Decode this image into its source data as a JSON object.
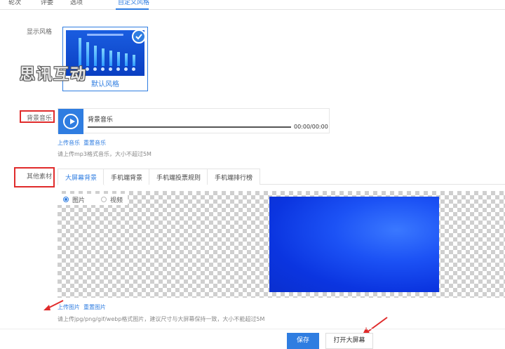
{
  "top_tabs": [
    {
      "label": "轮次",
      "active": false
    },
    {
      "label": "评委",
      "active": false
    },
    {
      "label": "选项",
      "active": false
    },
    {
      "label": "自定义风格",
      "active": true
    }
  ],
  "display_style": {
    "label": "显示风格",
    "card_caption": "默认风格",
    "selected": true
  },
  "watermark": "思讯互动",
  "music": {
    "label": "背景音乐",
    "track_name": "背景音乐",
    "time": "00:00/00:00",
    "upload_link": "上传音乐",
    "reset_link": "重置音乐",
    "hint": "请上传mp3格式音乐，大小不超过5M"
  },
  "other_material": {
    "label": "其他素材",
    "tabs": [
      {
        "label": "大屏幕背景",
        "active": true
      },
      {
        "label": "手机端背景",
        "active": false
      },
      {
        "label": "手机端投票规则",
        "active": false
      },
      {
        "label": "手机端排行榜",
        "active": false
      }
    ],
    "media_type": {
      "options": [
        "图片",
        "视频"
      ],
      "selected": "图片"
    },
    "upload_link": "上传图片",
    "reset_link": "重置图片",
    "hint": "请上传jpg/png/gif/webp格式图片，建议尺寸与大屏幕保持一致，大小不能超过5M"
  },
  "footer": {
    "save_label": "保存",
    "open_screen_label": "打开大屏幕"
  },
  "colors": {
    "accent": "#2f7de1",
    "annotation_red": "#e02b2b",
    "bg_image_blue": "#0b35e0"
  }
}
